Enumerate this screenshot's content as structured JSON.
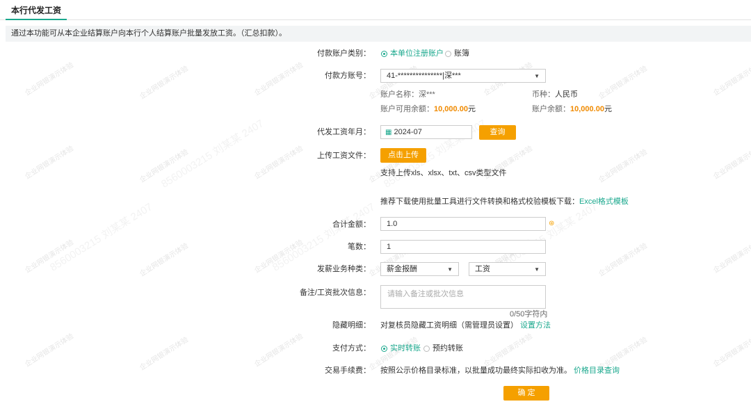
{
  "tab": {
    "label": "本行代发工资"
  },
  "notice": "通过本功能可从本企业结算账户向本行个人结算账户批量发放工资。（汇总扣款）。",
  "account_type": {
    "label": "付款账户类别：",
    "options": [
      "本单位注册账户",
      "账簿"
    ],
    "selected": "本单位注册账户"
  },
  "payer_account": {
    "label": "付款方账号：",
    "value": "41-***************|深***",
    "name_label": "账户名称：",
    "name_value": "深***",
    "currency_label": "币种：",
    "currency_value": "人民币",
    "available_label": "账户可用余额：",
    "available_value": "10,000.00",
    "available_unit": "元",
    "balance_label": "账户余额：",
    "balance_value": "10,000.00",
    "balance_unit": "元"
  },
  "pay_month": {
    "label": "代发工资年月：",
    "value": "2024-07",
    "query_button": "查询"
  },
  "upload": {
    "label": "上传工资文件：",
    "button": "点击上传",
    "hint": "支持上传xls、xlsx、txt、csv类型文件",
    "template_text": "推荐下载使用批量工具进行文件转换和格式校验模板下载：",
    "template_link": "Excel格式模板"
  },
  "total_amount": {
    "label": "合计金额：",
    "value": "1.0"
  },
  "count": {
    "label": "笔数：",
    "value": "1"
  },
  "business_type": {
    "label": "发薪业务种类：",
    "primary": "薪金报酬",
    "secondary": "工资"
  },
  "remark": {
    "label": "备注/工资批次信息：",
    "placeholder": "请输入备注或批次信息",
    "counter": "0/50字符内"
  },
  "hidden_detail": {
    "label": "隐藏明细：",
    "text": "对复核员隐藏工资明细（需管理员设置）",
    "link": "设置方法"
  },
  "pay_method": {
    "label": "支付方式：",
    "options": [
      "实时转账",
      "预约转账"
    ],
    "selected": "实时转账"
  },
  "fee": {
    "label": "交易手续费：",
    "text": "按照公示价格目录标准，以批量成功最终实际扣收为准。",
    "link": "价格目录查询"
  },
  "confirm_button": "确 定",
  "watermark": {
    "text": "企业网银演示体验",
    "id_text": "8560003215 刘某某 2407"
  },
  "colors": {
    "accent": "#1aa88d",
    "button": "#f5a000",
    "amount": "#f08a00"
  }
}
